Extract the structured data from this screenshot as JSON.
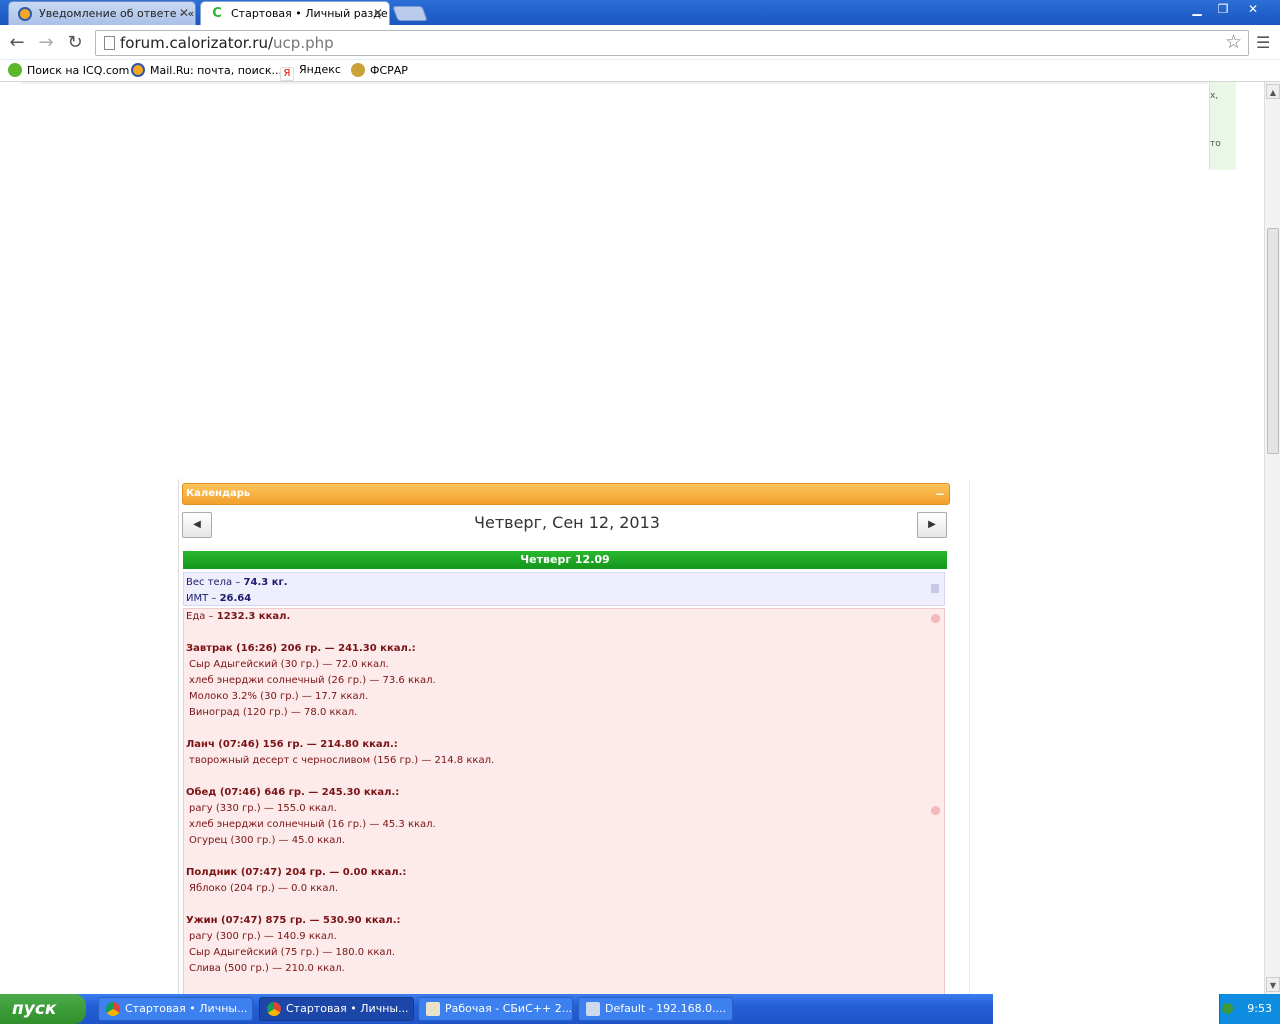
{
  "browser": {
    "tabs": [
      {
        "label": "Уведомление об ответе - «",
        "active": false
      },
      {
        "label": "Стартовая • Личный разде",
        "active": true
      }
    ],
    "url_host": "forum.calorizator.ru/",
    "url_path": "ucp.php",
    "bookmarks": [
      {
        "label": "Поиск на ICQ.com"
      },
      {
        "label": "Mail.Ru: почта, поиск..."
      },
      {
        "label": "Яндекс"
      },
      {
        "label": "ФСРАР"
      }
    ],
    "icons": {
      "back": "back-arrow-icon",
      "forward": "forward-arrow-icon",
      "reload": "reload-icon",
      "star": "star-icon",
      "menu": "wrench-icon"
    }
  },
  "page": {
    "side_text": [
      "х,",
      "то"
    ],
    "calendar": {
      "title": "Календарь",
      "collapse_glyph": "−",
      "prev_glyph": "◀",
      "next_glyph": "▶",
      "date_heading": "Четверг, Сен 12, 2013",
      "day_bar": "Четверг 12.09",
      "weight": {
        "label": "Вес тела",
        "value": "74.3 кг.",
        "bmi_label": "ИМТ",
        "bmi_value": "26.64"
      },
      "food_total": {
        "label": "Еда",
        "value": "1232.3 ккал."
      },
      "meals": [
        {
          "header": "Завтрак (16:26) 206 гр. — 241.30 ккал.:",
          "items": [
            "Сыр Адыгейский (30 гр.) — 72.0 ккал.",
            "хлеб энерджи солнечный (26 гр.) — 73.6 ккал.",
            "Молоко 3.2% (30 гр.) — 17.7 ккал.",
            "Виноград (120 гр.) — 78.0 ккал."
          ]
        },
        {
          "header": "Ланч (07:46) 156 гр. — 214.80 ккал.:",
          "items": [
            "творожный десерт с черносливом (156 гр.) — 214.8 ккал."
          ]
        },
        {
          "header": "Обед (07:46) 646 гр. — 245.30 ккал.:",
          "items": [
            "рагу (330 гр.) — 155.0 ккал.",
            "хлеб энерджи солнечный (16 гр.) — 45.3 ккал.",
            "Огурец (300 гр.) — 45.0 ккал."
          ]
        },
        {
          "header": "Полдник (07:47) 204 гр. — 0.00 ккал.:",
          "items": [
            "Яблоко (204 гр.) — 0.0 ккал."
          ]
        },
        {
          "header": "Ужин (07:47) 875 гр. — 530.90 ккал.:",
          "items": [
            "рагу (300 гр.) — 140.9 ккал.",
            "Сыр Адыгейский (75 гр.) — 180.0 ккал.",
            "Слива (500 гр.) — 210.0 ккал."
          ]
        }
      ]
    }
  },
  "taskbar": {
    "start": "пуск",
    "tasks": [
      {
        "label": "Стартовая • Личны..."
      },
      {
        "label": "Стартовая • Личны..."
      },
      {
        "label": "Рабочая - СБиС++ 2..."
      },
      {
        "label": "Default - 192.168.0...."
      }
    ],
    "clock": "9:53"
  },
  "colors": {
    "titlebar": "#1c56c0",
    "accent_orange": "#f3a02c",
    "day_green": "#14961c",
    "food_bg": "#fdeaea",
    "food_text": "#7a1414",
    "weight_text": "#1a1a6e"
  }
}
